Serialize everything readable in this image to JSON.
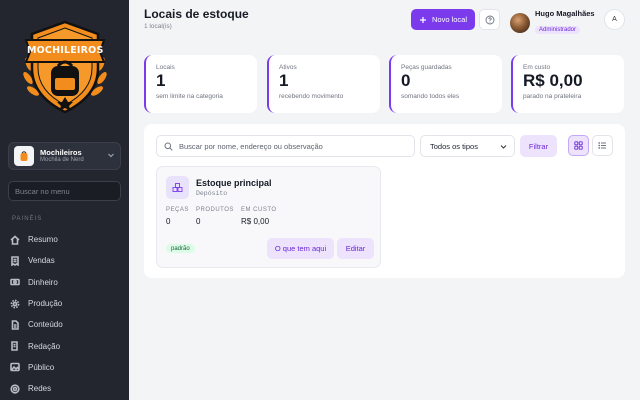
{
  "sidebar": {
    "logo_text": "MOCHILEIROS",
    "store": {
      "name": "Mochileiros",
      "subtitle": "Mochila de Nerd",
      "avatar_icon": "backpack-icon"
    },
    "search_placeholder": "Buscar no menu",
    "section_label": "PAINÉIS",
    "items": [
      {
        "label": "Resumo",
        "icon": "home-icon"
      },
      {
        "label": "Vendas",
        "icon": "receipt-icon"
      },
      {
        "label": "Dinheiro",
        "icon": "cash-icon"
      },
      {
        "label": "Produção",
        "icon": "gear-icon"
      },
      {
        "label": "Conteúdo",
        "icon": "document-icon"
      },
      {
        "label": "Redação",
        "icon": "edit-icon"
      },
      {
        "label": "Público",
        "icon": "image-icon"
      },
      {
        "label": "Redes",
        "icon": "network-icon"
      }
    ]
  },
  "header": {
    "title": "Locais de estoque",
    "subtitle": "1 local(is)",
    "new_button": "Novo local",
    "user": {
      "name": "Hugo Magalhães",
      "role": "Administrador"
    },
    "initial": "A"
  },
  "stats": [
    {
      "label": "Locais",
      "value": "1",
      "note": "sem limite na categoria"
    },
    {
      "label": "Ativos",
      "value": "1",
      "note": "recebendo movimento"
    },
    {
      "label": "Peças guardadas",
      "value": "0",
      "note": "somando todos eles"
    },
    {
      "label": "Em custo",
      "value": "R$ 0,00",
      "note": "parado na prateleira"
    }
  ],
  "filters": {
    "search_placeholder": "Buscar por nome, endereço ou observação",
    "type_select": "Todos os tipos",
    "filter_button": "Filtrar"
  },
  "locations": [
    {
      "name": "Estoque principal",
      "type": "Depósito",
      "metrics": [
        {
          "label": "PEÇAS",
          "value": "0"
        },
        {
          "label": "PRODUTOS",
          "value": "0"
        },
        {
          "label": "EM CUSTO",
          "value": "R$ 0,00"
        }
      ],
      "badge": "padrão",
      "action_view": "O que tem aqui",
      "action_edit": "Editar"
    }
  ],
  "colors": {
    "accent": "#7c3aed",
    "sidebar_bg": "#23262f",
    "logo_orange": "#f28c1c"
  }
}
